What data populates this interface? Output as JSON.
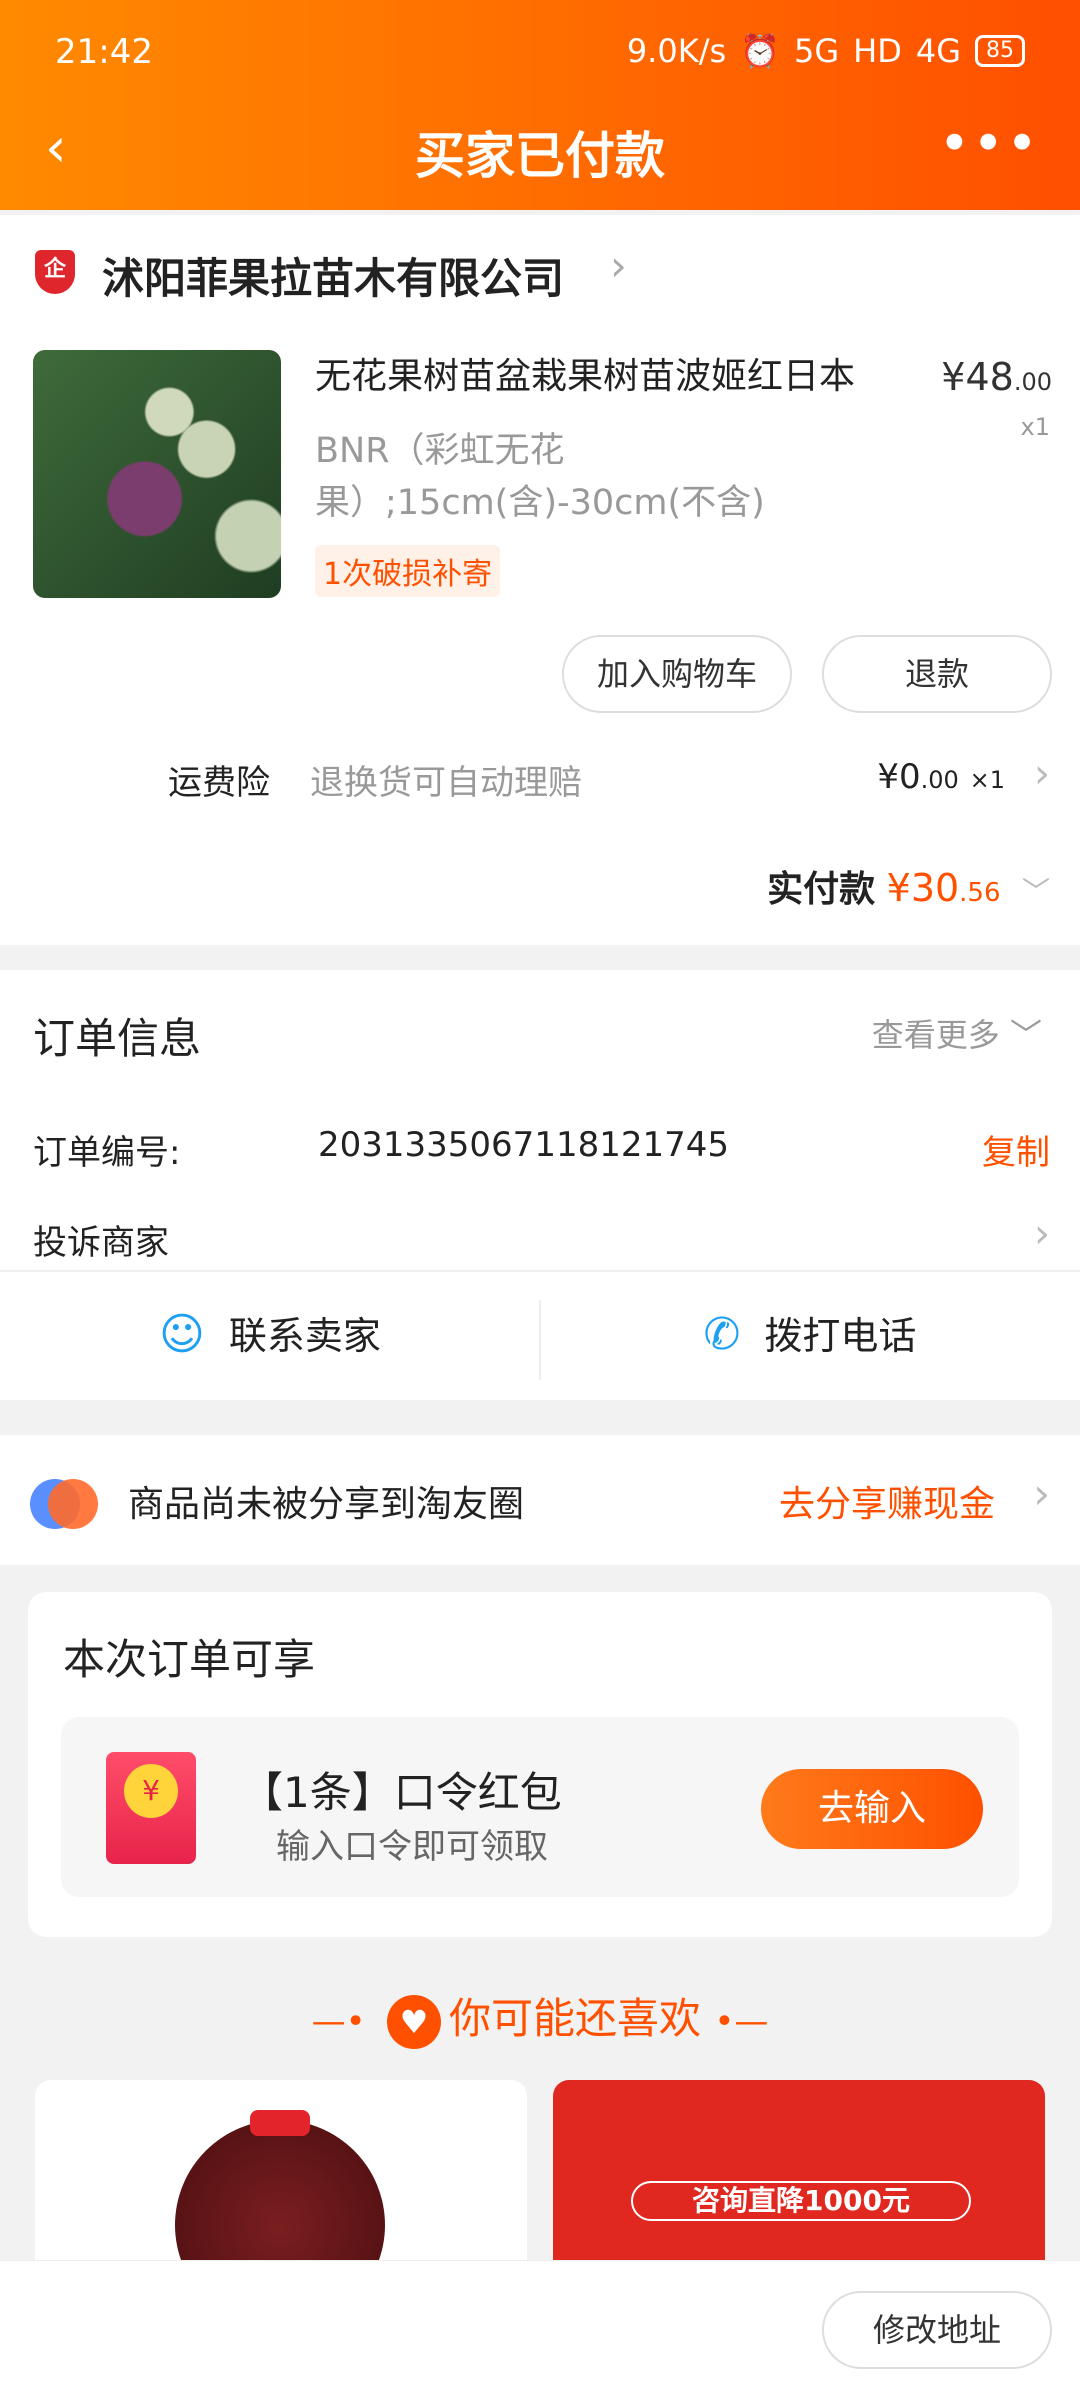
{
  "status": {
    "time": "21:42",
    "speed": "9.0K/s",
    "net1": "5G",
    "hd": "HD",
    "net2": "4G",
    "battery": "85"
  },
  "nav": {
    "back": "‹",
    "title": "买家已付款",
    "more": "•••"
  },
  "shop": {
    "badge": "企",
    "name": "沭阳菲果拉苗木有限公司",
    "product": {
      "title": "无花果树苗盆栽果树苗波姬红日本",
      "spec": "BNR（彩虹无花果）;15cm(含)-30cm(不含)",
      "price_main": "¥48",
      "price_dec": ".00",
      "qty": "x1",
      "tag": "1次破损补寄"
    },
    "btn_cart": "加入购物车",
    "btn_refund": "退款",
    "insurance": {
      "label": "运费险",
      "desc": "退换货可自动理赔",
      "value_main": "¥0",
      "value_dec": ".00",
      "qty": "×1"
    },
    "paid": {
      "label": "实付款",
      "amount_main": "¥30",
      "amount_dec": ".56"
    }
  },
  "order": {
    "heading": "订单信息",
    "more": "查看更多",
    "number_label": "订单编号:",
    "number_value": "2031335067118121745",
    "copy": "复制",
    "complain": "投诉商家",
    "contact_seller": "联系卖家",
    "call": "拨打电话"
  },
  "share": {
    "text": "商品尚未被分享到淘友圈",
    "link": "去分享赚现金"
  },
  "promo": {
    "heading": "本次订单可享",
    "title": "【1条】口令红包",
    "subtitle": "输入口令即可领取",
    "button": "去输入"
  },
  "recommend": {
    "title": "你可能还喜欢",
    "ad_text": "咨询直降1000元"
  },
  "bottom": {
    "button": "修改地址"
  },
  "colors": {
    "accent": "#ff5000",
    "header_start": "#ff8a00",
    "header_end": "#ff4f00",
    "link_blue": "#1ea0f2"
  }
}
